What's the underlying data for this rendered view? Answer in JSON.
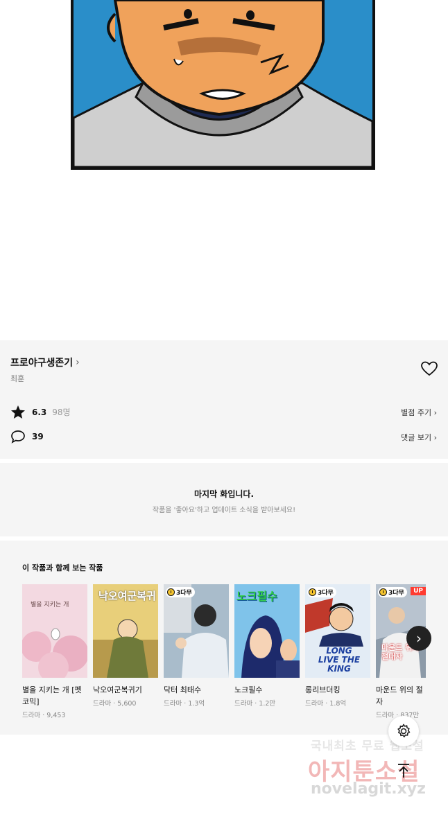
{
  "work": {
    "title": "프로야구생존기",
    "author": "최훈",
    "rating": "6.3",
    "rating_count": "98명",
    "comments": "39",
    "rate_link": "별점 주기",
    "comments_link": "댓글 보기"
  },
  "end": {
    "title": "마지막 화입니다.",
    "subtitle": "작품을 '좋아요'하고 업데이트 소식을 받아보세요!"
  },
  "recommend": {
    "heading": "이 작품과 함께 보는 작품",
    "items": [
      {
        "title": "별을 지키는 개 [펫코믹]",
        "meta": "드라마 · 9,453",
        "badge": "",
        "up": "",
        "cover_text": "별을 지키는 개",
        "bg": "#f3d9e1"
      },
      {
        "title": "낙오여군복귀기",
        "meta": "드라마 · 5,600",
        "badge": "",
        "up": "",
        "cover_text": "낙오여군복귀",
        "bg": "#d9b760"
      },
      {
        "title": "닥터 최태수",
        "meta": "드라마 · 1.3억",
        "badge": "3다무",
        "up": "",
        "cover_text": "",
        "bg": "#6f8aa0"
      },
      {
        "title": "노크필수",
        "meta": "드라마 · 1.2만",
        "badge": "",
        "up": "",
        "cover_text": "노크필수",
        "bg": "#3e8fd0"
      },
      {
        "title": "롱리브더킹",
        "meta": "드라마 · 1.8억",
        "badge": "3다무",
        "up": "",
        "cover_text": "LONG LIVE THE KING",
        "bg": "#c9d7e6"
      },
      {
        "title": "마운드 위의 절자",
        "meta": "드라마 · 837만",
        "badge": "3다무",
        "up": "UP",
        "cover_text": "마운드 위의 절대자",
        "bg": "#8c9aa8"
      }
    ]
  },
  "watermark": {
    "line1": "국내최초 무료 웹소설",
    "line2": "아지툰소설",
    "line3": "novelagit.xyz"
  }
}
